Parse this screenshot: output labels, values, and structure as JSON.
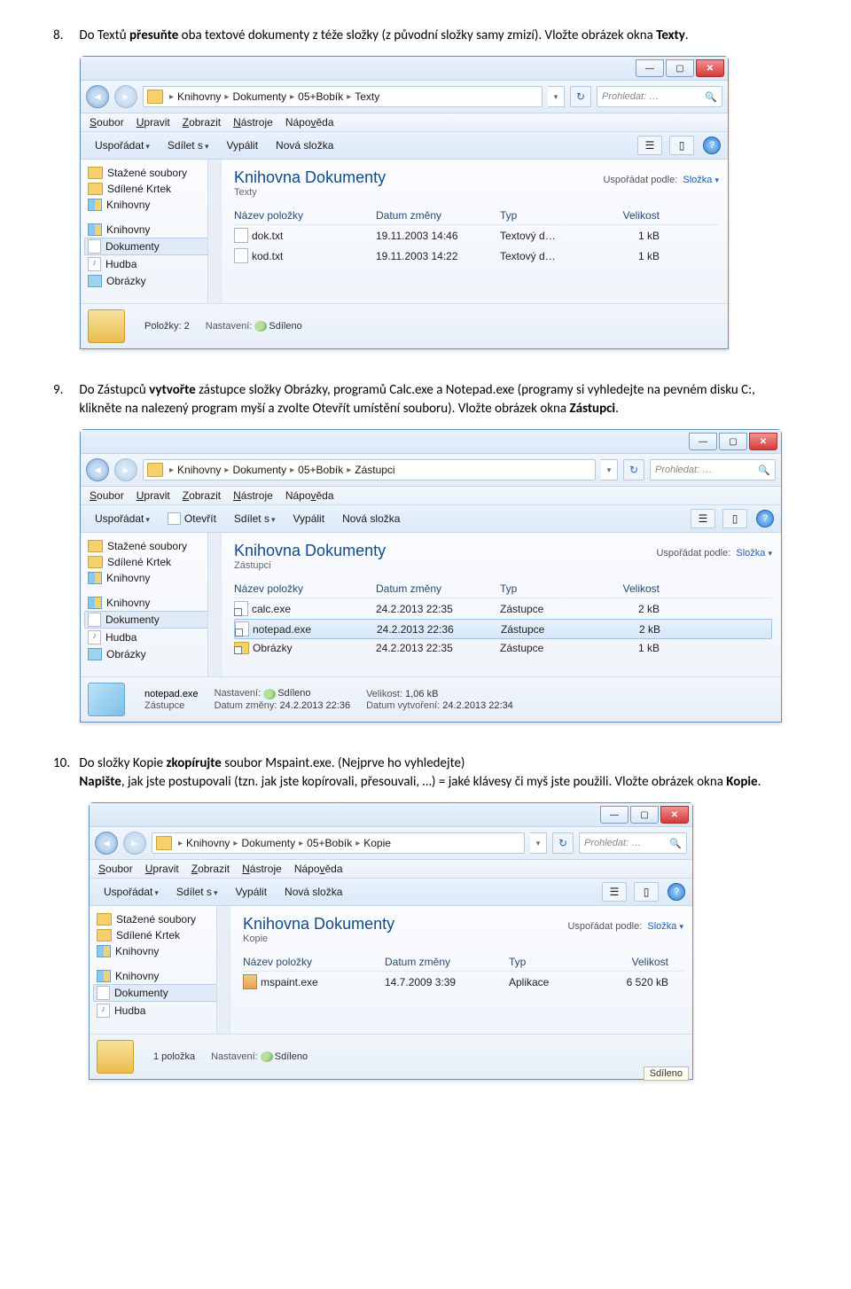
{
  "q8": {
    "num": "8.",
    "text_a": "Do Textů ",
    "bold_a": "přesuňte",
    "text_b": " oba textové dokumenty z téže složky (z původní složky samy zmizí). Vložte obrázek okna ",
    "bold_b": "Texty",
    "text_c": "."
  },
  "q9": {
    "num": "9.",
    "text_a": "Do Zástupců ",
    "bold_a": "vytvořte",
    "text_b": " zástupce složky Obrázky, programů Calc.exe a Notepad.exe (programy si vyhledejte na pevném disku C:, klikněte na nalezený program myší a zvolte Otevřít umístění souboru). Vložte obrázek okna ",
    "bold_b": "Zástupci",
    "text_c": "."
  },
  "q10": {
    "num": "10.",
    "text_a": "Do složky Kopie ",
    "bold_a": "zkopírujte",
    "text_b": " soubor Mspaint.exe. (Nejprve ho vyhledejte)",
    "line2_bold": "Napište",
    "line2": ", jak jste postupovali (tzn. jak jste kopírovali, přesouvali, …) = jaké klávesy či myš jste použili. Vložte obrázek okna ",
    "line2_bold_b": "Kopie",
    "line2_c": "."
  },
  "common": {
    "menubar": [
      "Soubor",
      "Upravit",
      "Zobrazit",
      "Nástroje",
      "Nápověda"
    ],
    "org_label": "Uspořádat",
    "share_label": "Sdílet s",
    "burn_label": "Vypálit",
    "newfolder_label": "Nová složka",
    "open_label": "Otevřít",
    "search_placeholder": "Prohledat: …",
    "lib_title": "Knihovna Dokumenty",
    "arrange_lbl": "Uspořádat podle:",
    "arrange_val": "Složka",
    "cols": {
      "name": "Název položky",
      "date": "Datum změny",
      "type": "Typ",
      "size": "Velikost"
    },
    "nav_top": [
      "Stažené soubory",
      "Sdílené Krtek",
      "Knihovny"
    ],
    "nav_libs_hdr": "Knihovny",
    "nav_libs": [
      "Dokumenty",
      "Hudba",
      "Obrázky"
    ],
    "nav_hudba": "Hudba",
    "status_share_lbl": "Nastavení:",
    "status_share_val": "Sdíleno"
  },
  "win1": {
    "bc": [
      "Knihovny",
      "Dokumenty",
      "05+Bobík",
      "Texty"
    ],
    "subtitle": "Texty",
    "rows": [
      {
        "name": "dok.txt",
        "date": "19.11.2003 14:46",
        "type": "Textový d…",
        "size": "1 kB"
      },
      {
        "name": "kod.txt",
        "date": "19.11.2003 14:22",
        "type": "Textový d…",
        "size": "1 kB"
      }
    ],
    "status_items": "Položky: 2"
  },
  "win2": {
    "bc": [
      "Knihovny",
      "Dokumenty",
      "05+Bobík",
      "Zástupci"
    ],
    "subtitle": "Zástupci",
    "rows": [
      {
        "name": "calc.exe",
        "date": "24.2.2013 22:35",
        "type": "Zástupce",
        "size": "2 kB"
      },
      {
        "name": "notepad.exe",
        "date": "24.2.2013 22:36",
        "type": "Zástupce",
        "size": "2 kB",
        "sel": true
      },
      {
        "name": "Obrázky",
        "date": "24.2.2013 22:35",
        "type": "Zástupce",
        "size": "1 kB",
        "folder": true
      }
    ],
    "status": {
      "name": "notepad.exe",
      "kind": "Zástupce",
      "mod_lbl": "Datum změny:",
      "mod_val": "24.2.2013 22:36",
      "size_lbl": "Velikost:",
      "size_val": "1,06 kB",
      "created_lbl": "Datum vytvoření:",
      "created_val": "24.2.2013 22:34"
    }
  },
  "win3": {
    "bc": [
      "Knihovny",
      "Dokumenty",
      "05+Bobík",
      "Kopie"
    ],
    "subtitle": "Kopie",
    "rows": [
      {
        "name": "mspaint.exe",
        "date": "14.7.2009 3:39",
        "type": "Aplikace",
        "size": "6 520 kB"
      }
    ],
    "status_items": "1 položka",
    "tooltip": "Sdíleno"
  }
}
